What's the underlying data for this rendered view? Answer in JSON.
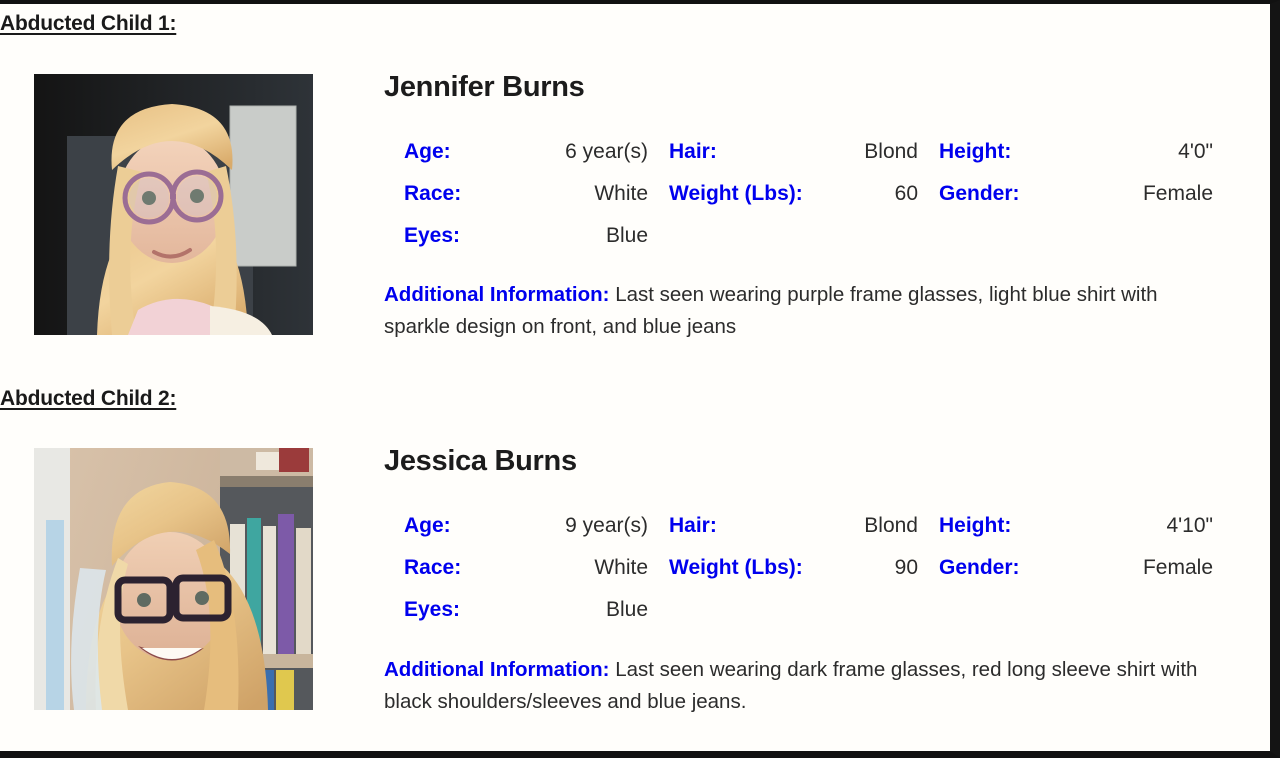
{
  "sections": [
    {
      "heading": "Abducted Child 1:",
      "name": "Jennifer Burns",
      "photo_alt": "photo-of-jennifer-burns",
      "attributes": {
        "age_label": "Age:",
        "age_value": "6 year(s)",
        "hair_label": "Hair:",
        "hair_value": "Blond",
        "height_label": "Height:",
        "height_value": "4'0\"",
        "race_label": "Race:",
        "race_value": "White",
        "weight_label": "Weight (Lbs):",
        "weight_value": "60",
        "gender_label": "Gender:",
        "gender_value": "Female",
        "eyes_label": "Eyes:",
        "eyes_value": "Blue"
      },
      "additional_label": "Additional Information:",
      "additional_text": "Last seen wearing purple frame glasses, light blue shirt with sparkle design on front, and blue jeans"
    },
    {
      "heading": "Abducted Child 2:",
      "name": "Jessica Burns",
      "photo_alt": "photo-of-jessica-burns",
      "attributes": {
        "age_label": "Age:",
        "age_value": "9 year(s)",
        "hair_label": "Hair:",
        "hair_value": "Blond",
        "height_label": "Height:",
        "height_value": "4'10\"",
        "race_label": "Race:",
        "race_value": "White",
        "weight_label": "Weight (Lbs):",
        "weight_value": "90",
        "gender_label": "Gender:",
        "gender_value": "Female",
        "eyes_label": "Eyes:",
        "eyes_value": "Blue"
      },
      "additional_label": "Additional Information:",
      "additional_text": "Last seen wearing dark frame glasses, red long sleeve shirt with black shoulders/sleeves and blue jeans."
    }
  ],
  "colors": {
    "label_blue": "#0000ee",
    "value_text": "#2c2c2c",
    "heading_text": "#1a1a1a",
    "page_background": "#fffefb",
    "border": "#111111"
  }
}
